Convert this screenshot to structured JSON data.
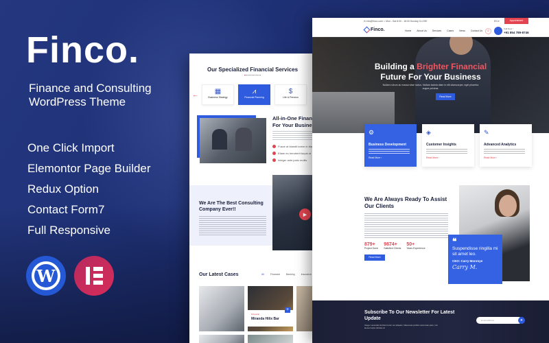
{
  "promo": {
    "brand": "Finco.",
    "tagline_line1": "Finance and Consulting",
    "tagline_line2": "WordPress Theme",
    "features": [
      "One Click Import",
      "Elemontor Page Builder",
      "Redux Option",
      "Contact Form7",
      "Full Responsive"
    ],
    "logos": [
      {
        "name": "wordpress-logo",
        "glyph": "W"
      },
      {
        "name": "elementor-logo",
        "glyph": "E"
      }
    ]
  },
  "colors": {
    "accent_blue": "#2f5bdf",
    "accent_red": "#e2444f",
    "dark_navy": "#1a1f3a"
  },
  "inner_page": {
    "services_title": "Our Specialized Financial Services",
    "services": [
      {
        "label": "Business Strategy",
        "icon": "strategy-icon",
        "glyph": "▦"
      },
      {
        "label": "Financial Planning",
        "icon": "chart-icon",
        "glyph": "📈",
        "active": true
      },
      {
        "label": "Life & Pension",
        "icon": "hand-coin-icon",
        "glyph": "✋"
      }
    ],
    "about_title_line1": "All-in-One Finan",
    "about_title_line2": "For Your Busines",
    "checklist": [
      "Fusce at blandit lorem in blandit libero",
      "Etiam eu hendrerit turpis ut",
      "Integer ante justo mollis"
    ],
    "best_title": "We Are The Best Consulting Company Ever!!",
    "cases_title": "Our Latest Cases",
    "case_tabs": [
      "All",
      "Financial",
      "Banking",
      "Insurance"
    ],
    "case_card": {
      "category": "Financial",
      "title": "Miranda Hilix Bar"
    }
  },
  "home_page": {
    "topbar": {
      "info": "✉ info@finco.com   ⌂ Mon - Sat 8:00 - 18:00 Sunday CLOSE",
      "lang": "EN ▾",
      "appointment": "Appointment"
    },
    "logo": "Finco.",
    "menu": [
      "Home",
      "About Us",
      "Services",
      "Cases",
      "News",
      "Contact Us"
    ],
    "call_label": "Call Now !",
    "call_number": "+91 854 789-8746",
    "hero": {
      "title_a": "Building a ",
      "title_highlight": "Brighter Financial",
      "title_b": "Future For Your Business",
      "subtitle": "Nullam rutrum ac massa vitae luctus. Nullam lacinia diam in elit ullamcorper, eget pharetra augue pulvinar.",
      "button": "Read More"
    },
    "feature_cards": [
      {
        "title": "Business Development",
        "glyph": "⚙",
        "link": "Read More ›",
        "active": true
      },
      {
        "title": "Customer Insights",
        "glyph": "◈",
        "link": "Read More ›"
      },
      {
        "title": "Advanced Analytics",
        "glyph": "✎",
        "link": "Read More ›"
      }
    ],
    "assist": {
      "title": "We Are Always Ready To Assist Our Clients",
      "stats": [
        {
          "value": "879+",
          "label": "Project Done"
        },
        {
          "value": "9874+",
          "label": "Satisfied Clients"
        },
        {
          "value": "50+",
          "label": "Years Experience"
        }
      ],
      "button": "Read More"
    },
    "quote": {
      "mark": "❝",
      "text": "Suspendisse ringilla mi sit amet leo.",
      "author": "CEO: Carry Monroye",
      "signature": "Carry M."
    },
    "newsletter": {
      "title": "Subscribe To Our Newsletter For Latest Update",
      "text": "Integer venenatis tincidunt tortor nec aliquam. Maecenas porttitor accumsan justo, non laoreet turpis ultricies id.",
      "placeholder": "Email address",
      "send_glyph": "➤"
    }
  }
}
